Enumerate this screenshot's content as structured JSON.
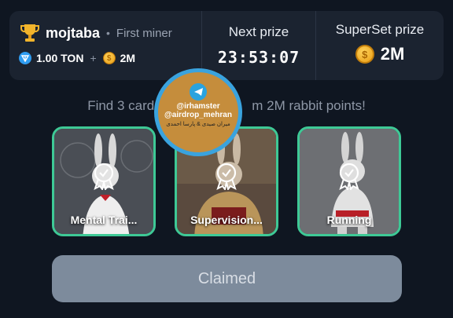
{
  "user": {
    "name": "mojtaba",
    "rank": "First miner",
    "ton_balance": "1.00 TON",
    "points": "2M"
  },
  "next_prize": {
    "label": "Next prize",
    "timer": "23:53:07"
  },
  "superset_prize": {
    "label": "SuperSet prize",
    "value": "2M"
  },
  "instruction": "Find 3 card",
  "instruction_tail": "m 2M rabbit points!",
  "cards": [
    {
      "label": "Mental Trai..."
    },
    {
      "label": "Supervision..."
    },
    {
      "label": "Running"
    }
  ],
  "watermark": {
    "line1": "@irhamster",
    "line2": "@airdrop_mehran",
    "line3": "میران صیدی & پارسا احمدی"
  },
  "claim_button": "Claimed",
  "colors": {
    "background": "#0f1621",
    "card_border": "#3ec996",
    "button": "#7d8b9c",
    "coin": "#f0a81f"
  }
}
